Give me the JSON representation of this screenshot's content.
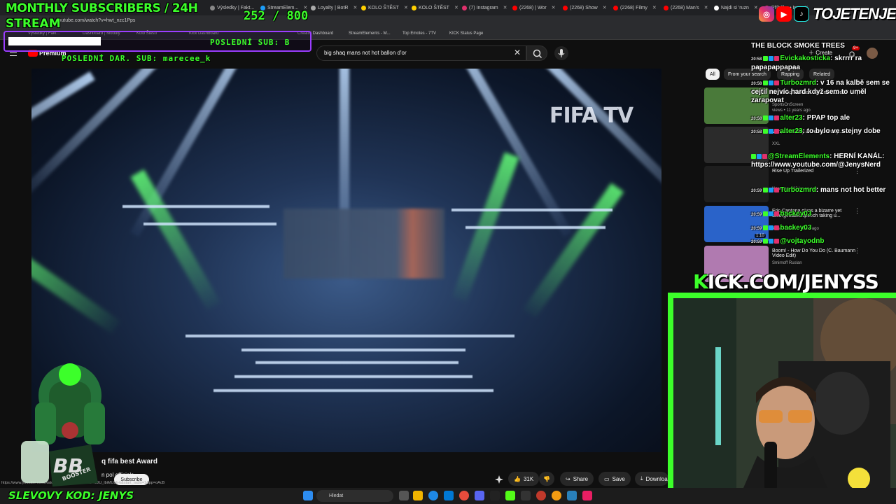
{
  "browser": {
    "tabs": [
      {
        "label": "Výsledky | Fakt...",
        "color": "#888888"
      },
      {
        "label": "StreamElem...",
        "color": "#1c9cf6"
      },
      {
        "label": "Loyalty | BotR",
        "color": "#aaaaaa"
      },
      {
        "label": "KOLO ŠTĚST",
        "color": "#ffd000"
      },
      {
        "label": "KOLO ŠTĚST",
        "color": "#ffd000"
      },
      {
        "label": "(7) Instagram",
        "color": "#e1306c"
      },
      {
        "label": "(2268) | Wor",
        "color": "#ff0000"
      },
      {
        "label": "(2268) Show",
        "color": "#ff0000"
      },
      {
        "label": "(2268) Filmy",
        "color": "#ff0000"
      },
      {
        "label": "(2268) Man's",
        "color": "#ff0000"
      },
      {
        "label": "Najdi si 'ruzn",
        "color": "#ffffff"
      },
      {
        "label": "Příběhy • Ins",
        "color": "#e1306c"
      }
    ],
    "url": "youtube.com/watch?v=hwt_nzc1Pps",
    "bookmarks": [
      "Výsledky | Fakt...",
      "Dashboard | Moduly",
      "Kolo Štěstí",
      "Kick Dashboard",
      "Creator Dashboard",
      "StreamElements - M...",
      "Top Emotes - 7TV",
      "KICK Status Page"
    ]
  },
  "youtube": {
    "logo_label": "Premium",
    "search_value": "big shaq mans not hot ballon d'or",
    "video_watermark": "FIFA TV",
    "video_title": "q fifa best Award",
    "channel_name": "n pol officials",
    "subscribe_label": "Subscribe",
    "like_count": "31K",
    "share_label": "Share",
    "save_label": "Save",
    "download_label": "Download",
    "status_url": "https://www.youtube.com/watch?v=U_lbiMUbh-k&list=RDU_lbiMUbh-k&start_radio=1&pp=oAcB",
    "create_label": "Create",
    "notification_count": "9+",
    "chips": [
      "All",
      "From your search",
      "Rapping",
      "Related"
    ],
    "related": [
      {
        "title": "Big Shaq Football - Winner Takes",
        "channel": "SportsOnScreen",
        "meta": "views • 11 years ago",
        "thumb": "#4a7a3a"
      },
      {
        "title": "Vert, Lil Yachty & Denzel Curry...",
        "channel": "XXL",
        "meta": "",
        "thumb": "#2b2b2b"
      },
      {
        "title": "Rise Up Trailerized",
        "channel": "",
        "meta": "No views • 12 hours ago",
        "thumb": "#1e1e1e"
      },
      {
        "title": "Eric Cantona gives a bizarre yet unforgettable speech taking u...",
        "channel": "",
        "meta": "4.2M views • 6 years ago",
        "thumb": "#2a63c9",
        "duration": "1:10"
      },
      {
        "title": "Boom! - How Do You Do (C. Baumann Video Edit)",
        "channel": "Smirnoff Ruslan",
        "meta": "",
        "thumb": "#b07ab0"
      }
    ]
  },
  "overlay": {
    "monthly_label": "MONTHLY SUBSCRIBERS / 24H",
    "stream_label": "STREAM",
    "sub_count": "252",
    "sub_separator": "/",
    "sub_goal": "800",
    "sub_progress": 0.315,
    "last_sub": "POSLEDNÍ SUB: B",
    "last_donation": "POSLEDNÍ DAR. SUB: marecee_k",
    "handle": "TOJETENJENYS",
    "kick_url_k": "K",
    "kick_url_rest": "ICK.COM/JENYSS",
    "promo": "SLEVOVY KOD: JENYS",
    "mascot_text": "BOOSTER"
  },
  "chat": [
    {
      "time": "",
      "user": "",
      "text": "THE BLOCK SMOKE TREES"
    },
    {
      "time": "20:58",
      "user": "Evickakosticka",
      "text": ": skrrrr ra papapappapaa"
    },
    {
      "time": "20:58",
      "user": "Turbozmrd",
      "text": ": v 16 na kalbě sem se cejtil nejvíc hard když sem to uměl zarapovat"
    },
    {
      "time": "20:58",
      "user": "alter23",
      "text": ": PPAP top ale"
    },
    {
      "time": "20:58",
      "user": "alter23",
      "text": ": to bylo ve stejny dobe"
    },
    {
      "time": "",
      "user": "@StreamElements",
      "text": ": HERNÍ KANÁL: https://www.youtube.com/@JenysNerd"
    },
    {
      "time": "20:59",
      "user": "Turbozmrd",
      "text": ": mans not hot better"
    },
    {
      "time": "20:59",
      "user": "backey03",
      "text": ""
    },
    {
      "time": "20:59",
      "user": "backey03",
      "text": ""
    },
    {
      "time": "20:59",
      "user": "@vojtayodnb",
      "text": ""
    }
  ],
  "taskbar": {
    "search_placeholder": "Hledat"
  },
  "colors": {
    "accent_green": "#3cff2a",
    "overlay_purple": "#9b3dff",
    "youtube_red": "#ff0000"
  }
}
